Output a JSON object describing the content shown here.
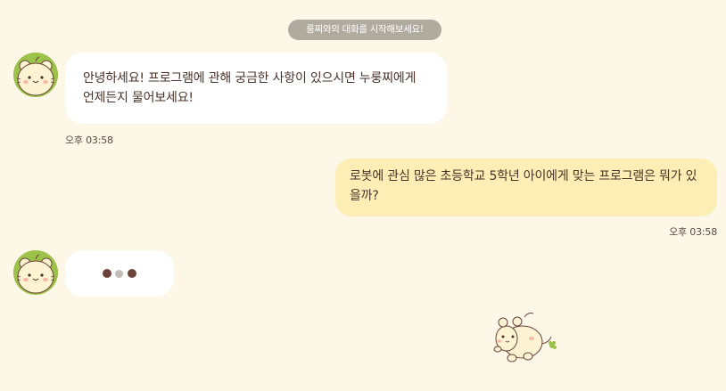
{
  "chat": {
    "system_message": "룽찌와의 대화를 시작해보세요!",
    "messages": [
      {
        "sender": "bot",
        "line1": "안녕하세요! 프로그램에 관해 궁금한 사항이 있으시면 누룽찌에게",
        "line2": "언제든지 물어보세요!",
        "time": "오후 03:58"
      },
      {
        "sender": "user",
        "line1": "로봇에 관심 많은 초등학교 5학년 아이에게 맞는 프로그램은 뭐가 있",
        "line2": "을까?",
        "time": "오후 03:58"
      }
    ],
    "typing_indicator": {
      "icon": "typing-dots-icon"
    }
  },
  "bot": {
    "avatar_icon": "hamster-mascot-avatar"
  },
  "colors": {
    "background": "#fdf7e8",
    "bot_bubble": "#ffffff",
    "user_bubble": "#fdeeb5",
    "system_pill": "#b0aa9f",
    "avatar_ring": "#9cc24a",
    "text": "#4a3228"
  }
}
